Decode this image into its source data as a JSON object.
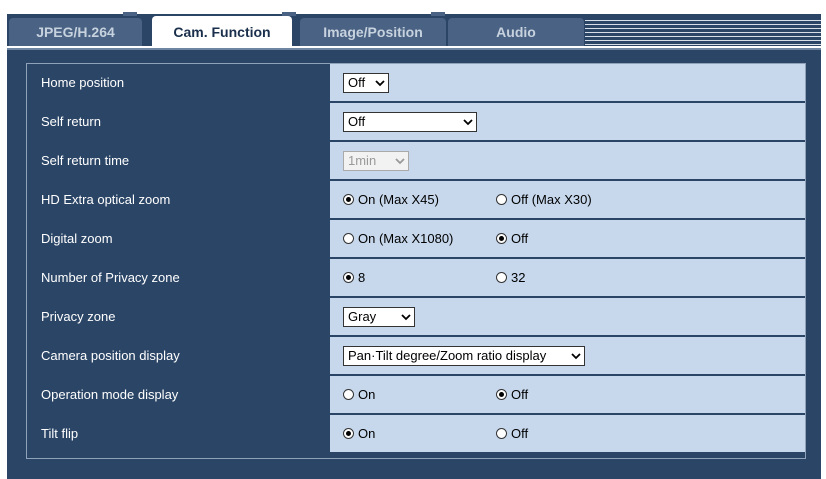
{
  "tabs": [
    {
      "label": "JPEG/H.264",
      "active": false
    },
    {
      "label": "Cam. Function",
      "active": true
    },
    {
      "label": "Image/Position",
      "active": false
    },
    {
      "label": "Audio",
      "active": false
    }
  ],
  "settings": {
    "home_position": {
      "label": "Home position",
      "value": "Off"
    },
    "self_return": {
      "label": "Self return",
      "value": "Off"
    },
    "self_return_time": {
      "label": "Self return time",
      "value": "1min"
    },
    "hd_extra_zoom": {
      "label": "HD Extra optical zoom",
      "option_on": "On (Max X45)",
      "option_off": "Off (Max X30)",
      "selected": "on"
    },
    "digital_zoom": {
      "label": "Digital zoom",
      "option_on": "On (Max X1080)",
      "option_off": "Off",
      "selected": "off"
    },
    "privacy_zone_number": {
      "label": "Number of Privacy zone",
      "option_a": "8",
      "option_b": "32",
      "selected": "8"
    },
    "privacy_zone": {
      "label": "Privacy zone",
      "value": "Gray"
    },
    "camera_position_display": {
      "label": "Camera position display",
      "value": "Pan·Tilt degree/Zoom ratio display"
    },
    "operation_mode_display": {
      "label": "Operation mode display",
      "option_on": "On",
      "option_off": "Off",
      "selected": "off"
    },
    "tilt_flip": {
      "label": "Tilt flip",
      "option_on": "On",
      "option_off": "Off",
      "selected": "on"
    }
  },
  "colors": {
    "panel_bg": "#2b4566",
    "value_bg": "#c7d8ed",
    "label_text": "#ffffff"
  }
}
